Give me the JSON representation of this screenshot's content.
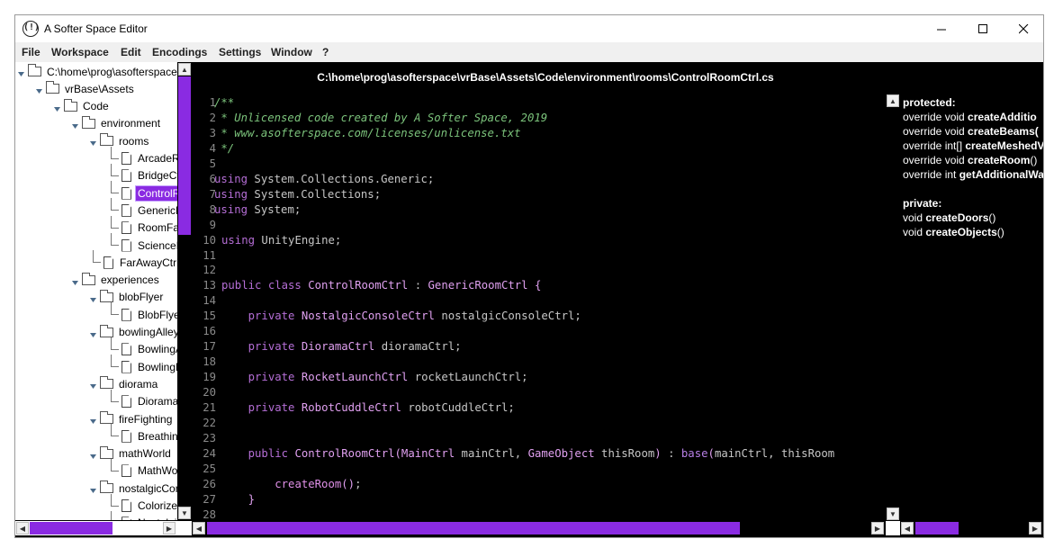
{
  "window": {
    "title": "A Softer Space Editor",
    "icon_glyph": "(!)",
    "controls": [
      "minimize-icon",
      "maximize-icon",
      "close-icon"
    ]
  },
  "menu": {
    "items": [
      "File",
      "Workspace",
      "Edit",
      "Encodings",
      "Settings",
      "Window",
      "?"
    ]
  },
  "tree": {
    "items": [
      {
        "label": "C:\\home\\prog\\asofterspace",
        "type": "folder",
        "depth": 0,
        "expanded": true
      },
      {
        "label": "vrBase\\Assets",
        "type": "folder",
        "depth": 1,
        "expanded": true
      },
      {
        "label": "Code",
        "type": "folder",
        "depth": 2,
        "expanded": true
      },
      {
        "label": "environment",
        "type": "folder",
        "depth": 3,
        "expanded": true
      },
      {
        "label": "rooms",
        "type": "folder",
        "depth": 4,
        "expanded": true
      },
      {
        "label": "ArcadeRoo",
        "type": "file",
        "depth": 5
      },
      {
        "label": "BridgeCtrl.",
        "type": "file",
        "depth": 5
      },
      {
        "label": "ControlRoo",
        "type": "file",
        "depth": 5,
        "selected": true
      },
      {
        "label": "GenericRo",
        "type": "file",
        "depth": 5
      },
      {
        "label": "RoomFacto",
        "type": "file",
        "depth": 5
      },
      {
        "label": "ScienceRo",
        "type": "file",
        "depth": 5
      },
      {
        "label": "FarAwayCtrl.cs",
        "type": "file",
        "depth": 4
      },
      {
        "label": "experiences",
        "type": "folder",
        "depth": 3,
        "expanded": true
      },
      {
        "label": "blobFlyer",
        "type": "folder",
        "depth": 4,
        "expanded": true
      },
      {
        "label": "BlobFlyerC",
        "type": "file",
        "depth": 5
      },
      {
        "label": "bowlingAlley",
        "type": "folder",
        "depth": 4,
        "expanded": true
      },
      {
        "label": "BowlingAll",
        "type": "file",
        "depth": 5
      },
      {
        "label": "BowlingBa",
        "type": "file",
        "depth": 5
      },
      {
        "label": "diorama",
        "type": "folder",
        "depth": 4,
        "expanded": true
      },
      {
        "label": "DioramaCt",
        "type": "file",
        "depth": 5
      },
      {
        "label": "fireFighting",
        "type": "folder",
        "depth": 4,
        "expanded": true
      },
      {
        "label": "BreathingA",
        "type": "file",
        "depth": 5
      },
      {
        "label": "mathWorld",
        "type": "folder",
        "depth": 4,
        "expanded": true
      },
      {
        "label": "MathWorld",
        "type": "file",
        "depth": 5
      },
      {
        "label": "nostalgicCons",
        "type": "folder",
        "depth": 4,
        "expanded": true
      },
      {
        "label": "ColorizeBu",
        "type": "file",
        "depth": 5
      },
      {
        "label": "NostalgicC",
        "type": "file",
        "depth": 5
      }
    ]
  },
  "editor": {
    "path": "C:\\home\\prog\\asofterspace\\vrBase\\Assets\\Code\\environment\\rooms\\ControlRoomCtrl.cs",
    "lines": [
      {
        "n": "1",
        "t": [
          [
            "comment",
            "/**"
          ]
        ]
      },
      {
        "n": "2",
        "t": [
          [
            "comment",
            " * Unlicensed code created by A Softer Space, 2019"
          ]
        ]
      },
      {
        "n": "3",
        "t": [
          [
            "comment",
            " * www.asofterspace.com/licenses/unlicense.txt"
          ]
        ]
      },
      {
        "n": "4",
        "t": [
          [
            "comment",
            " */"
          ]
        ]
      },
      {
        "n": "5",
        "t": []
      },
      {
        "n": "6",
        "t": [
          [
            "kw",
            "using"
          ],
          [
            "plain",
            " System.Collections.Generic;"
          ]
        ]
      },
      {
        "n": "7",
        "t": [
          [
            "kw",
            "using"
          ],
          [
            "plain",
            " System.Collections;"
          ]
        ]
      },
      {
        "n": "8",
        "t": [
          [
            "kw",
            "using"
          ],
          [
            "plain",
            " System;"
          ]
        ]
      },
      {
        "n": "9",
        "t": []
      },
      {
        "n": "10",
        "t": [
          [
            "kw",
            "using"
          ],
          [
            "plain",
            " UnityEngine;"
          ]
        ]
      },
      {
        "n": "11",
        "t": []
      },
      {
        "n": "12",
        "t": []
      },
      {
        "n": "13",
        "t": [
          [
            "kw",
            "public class"
          ],
          [
            "plain",
            " "
          ],
          [
            "type",
            "ControlRoomCtrl"
          ],
          [
            "plain",
            " : "
          ],
          [
            "type",
            "GenericRoomCtrl"
          ],
          [
            "type",
            " {"
          ]
        ]
      },
      {
        "n": "14",
        "t": []
      },
      {
        "n": "15",
        "t": [
          [
            "plain",
            "    "
          ],
          [
            "kw",
            "private"
          ],
          [
            "plain",
            " "
          ],
          [
            "type",
            "NostalgicConsoleCtrl"
          ],
          [
            "plain",
            " nostalgicConsoleCtrl;"
          ]
        ]
      },
      {
        "n": "16",
        "t": []
      },
      {
        "n": "17",
        "t": [
          [
            "plain",
            "    "
          ],
          [
            "kw",
            "private"
          ],
          [
            "plain",
            " "
          ],
          [
            "type",
            "DioramaCtrl"
          ],
          [
            "plain",
            " dioramaCtrl;"
          ]
        ]
      },
      {
        "n": "18",
        "t": []
      },
      {
        "n": "19",
        "t": [
          [
            "plain",
            "    "
          ],
          [
            "kw",
            "private"
          ],
          [
            "plain",
            " "
          ],
          [
            "type",
            "RocketLaunchCtrl"
          ],
          [
            "plain",
            " rocketLaunchCtrl;"
          ]
        ]
      },
      {
        "n": "20",
        "t": []
      },
      {
        "n": "21",
        "t": [
          [
            "plain",
            "    "
          ],
          [
            "kw",
            "private"
          ],
          [
            "plain",
            " "
          ],
          [
            "type",
            "RobotCuddleCtrl"
          ],
          [
            "plain",
            " robotCuddleCtrl;"
          ]
        ]
      },
      {
        "n": "22",
        "t": []
      },
      {
        "n": "23",
        "t": []
      },
      {
        "n": "24",
        "t": [
          [
            "plain",
            "    "
          ],
          [
            "kw",
            "public"
          ],
          [
            "plain",
            " "
          ],
          [
            "type",
            "ControlRoomCtrl"
          ],
          [
            "type",
            "("
          ],
          [
            "type",
            "MainCtrl"
          ],
          [
            "plain",
            " mainCtrl, "
          ],
          [
            "type",
            "GameObject"
          ],
          [
            "plain",
            " thisRoom"
          ],
          [
            "type",
            ")"
          ],
          [
            "plain",
            " : "
          ],
          [
            "base",
            "base"
          ],
          [
            "type",
            "("
          ],
          [
            "plain",
            "mainCtrl, thisRoom"
          ]
        ]
      },
      {
        "n": "25",
        "t": []
      },
      {
        "n": "26",
        "t": [
          [
            "plain",
            "        "
          ],
          [
            "call",
            "createRoom"
          ],
          [
            "type",
            "()"
          ],
          [
            "plain",
            ";"
          ]
        ]
      },
      {
        "n": "27",
        "t": [
          [
            "plain",
            "    "
          ],
          [
            "type",
            "}"
          ]
        ]
      },
      {
        "n": "28",
        "t": []
      }
    ]
  },
  "outline": {
    "rows": [
      {
        "kind": "head",
        "text": "protected:"
      },
      {
        "kind": "entry",
        "prefix": "override void ",
        "name": "createAdditio"
      },
      {
        "kind": "entry",
        "prefix": "override void ",
        "name": "createBeams("
      },
      {
        "kind": "entry",
        "prefix": "override int[] ",
        "name": "createMeshedV"
      },
      {
        "kind": "entry",
        "prefix": "override void ",
        "name": "createRoom",
        "suffix": "()"
      },
      {
        "kind": "entry",
        "prefix": "override int ",
        "name": "getAdditionalWa"
      },
      {
        "kind": "blank"
      },
      {
        "kind": "head",
        "text": "private:"
      },
      {
        "kind": "entry",
        "prefix": "void ",
        "name": "createDoors",
        "suffix": "()"
      },
      {
        "kind": "entry",
        "prefix": "void ",
        "name": "createObjects",
        "suffix": "()"
      }
    ]
  },
  "colors": {
    "accent": "#8a2be2",
    "comment": "#7cc47c",
    "keyword": "#b56ed6",
    "type": "#e0a0f0",
    "editor_bg": "#000000"
  }
}
